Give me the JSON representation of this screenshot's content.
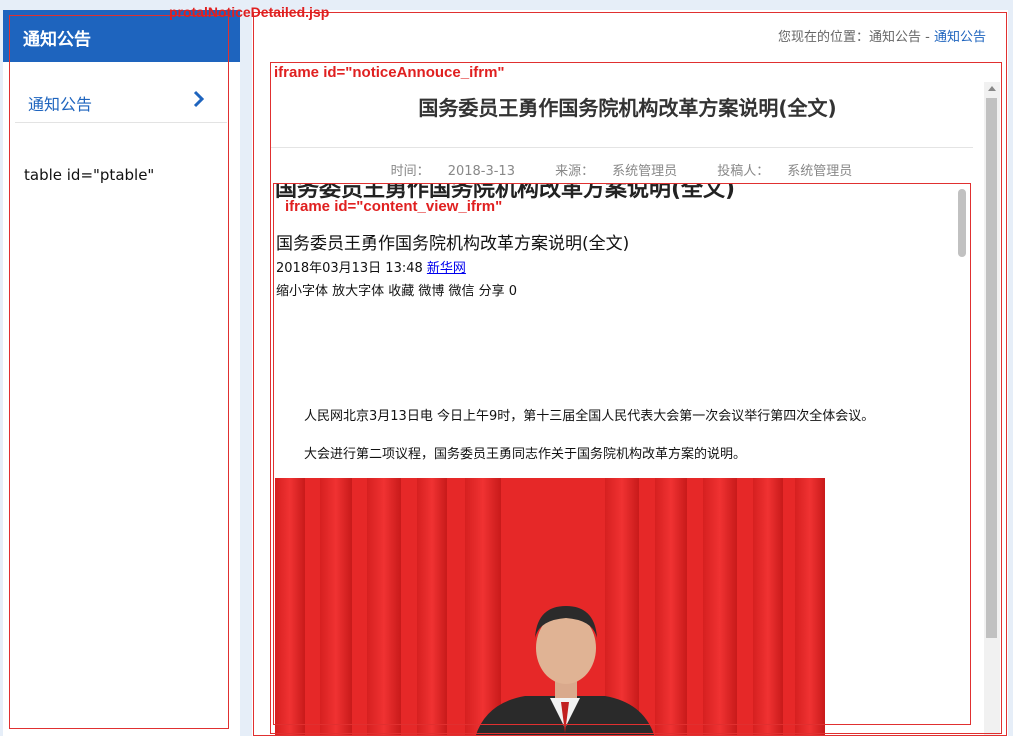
{
  "annotations": {
    "jsp": "protalNoticeDetailed.jsp",
    "outer_iframe": "iframe id=\"noticeAnnouce_ifrm\"",
    "inner_iframe": "iframe id=\"content_view_ifrm\"",
    "table": "table id=\"ptable\""
  },
  "sidebar": {
    "header": "通知公告",
    "items": [
      {
        "label": "通知公告",
        "icon": "chevron-right-icon"
      }
    ]
  },
  "breadcrumb": {
    "prefix": "您现在的位置：",
    "section": "通知公告",
    "separator": " - ",
    "current": "通知公告"
  },
  "notice": {
    "title": "国务委员王勇作国务院机构改革方案说明(全文)",
    "time_label": "时间：",
    "time": "2018-3-13",
    "source_label": "来源：",
    "source": "系统管理员",
    "author_label": "投稿人：",
    "author": "系统管理员"
  },
  "article": {
    "cut_title": "国务委员王勇作国务院机构改革方案说明(全文)",
    "title": "国务委员王勇作国务院机构改革方案说明(全文)",
    "date": "2018年03月13日 13:48",
    "source_link": "新华网",
    "tools": "缩小字体 放大字体 收藏 微博 微信 分享 0",
    "p1": "人民网北京3月13日电 今日上午9时，第十三届全国人民代表大会第一次会议举行第四次全体会议。",
    "p2": "大会进行第二项议程，国务委员王勇同志作关于国务院机构改革方案的说明。"
  },
  "colors": {
    "brand": "#1e64be",
    "annotation": "#e02020",
    "background": "#e6eef8"
  }
}
